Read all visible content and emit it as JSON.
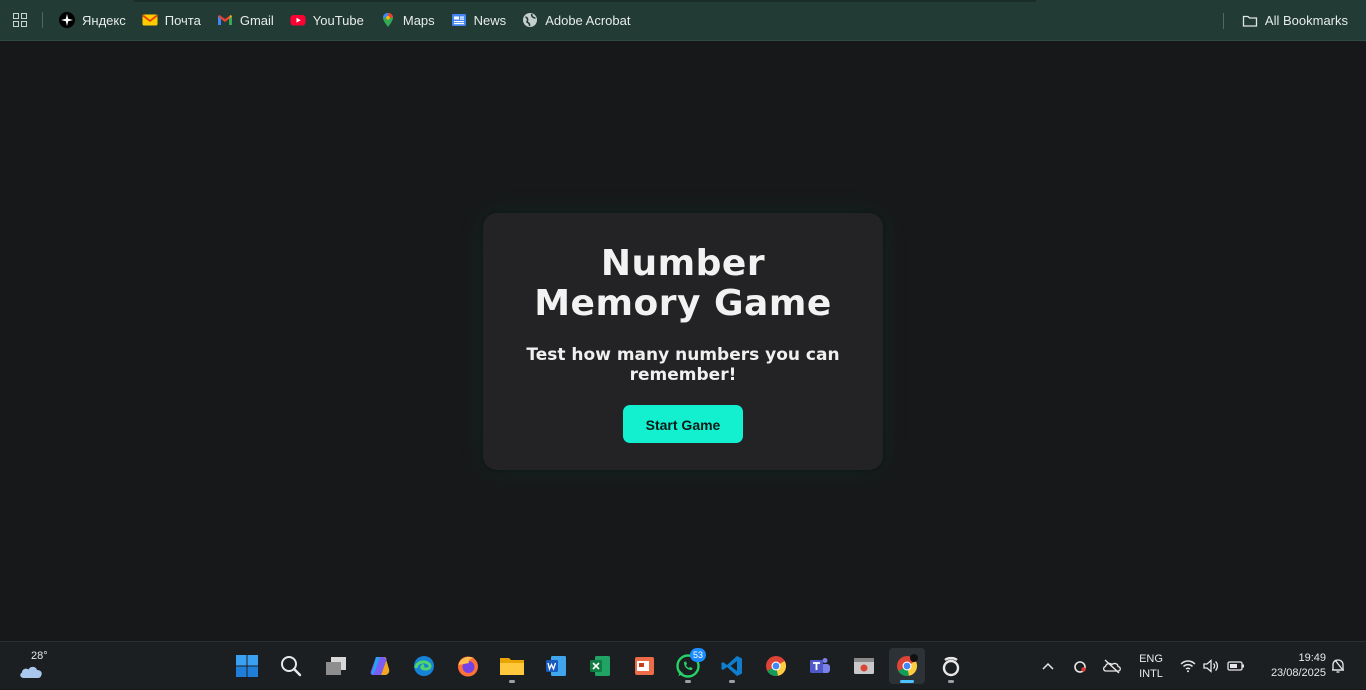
{
  "bookmarks": {
    "items": [
      {
        "label": "Яндекс",
        "icon": "yandex-icon"
      },
      {
        "label": "Почта",
        "icon": "mail-icon"
      },
      {
        "label": "Gmail",
        "icon": "gmail-icon"
      },
      {
        "label": "YouTube",
        "icon": "youtube-icon"
      },
      {
        "label": "Maps",
        "icon": "maps-icon"
      },
      {
        "label": "News",
        "icon": "news-icon"
      },
      {
        "label": "Adobe Acrobat",
        "icon": "globe-icon"
      }
    ],
    "all_bookmarks_label": "All Bookmarks"
  },
  "game": {
    "title": "Number Memory Game",
    "subtitle": "Test how many numbers you can remember!",
    "start_label": "Start Game",
    "accent_color": "#12f0cf"
  },
  "taskbar": {
    "weather_temp": "28°",
    "whatsapp_badge": "53",
    "language_line1": "ENG",
    "language_line2": "INTL",
    "time": "19:49",
    "date": "23/08/2025"
  },
  "colors": {
    "bookmarks_bar": "#233b35",
    "page_background": "#171819",
    "card_background": "#232325",
    "taskbar": "#1c1f22"
  }
}
